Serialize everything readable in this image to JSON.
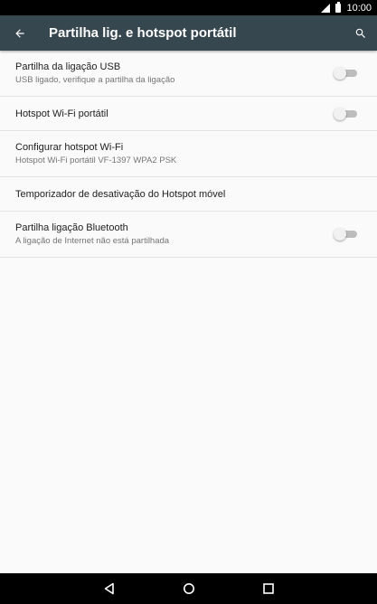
{
  "status_bar": {
    "time": "10:00",
    "icons": [
      "signal-icon",
      "battery-icon"
    ]
  },
  "app_bar": {
    "title": "Partilha lig. e hotspot portátil",
    "back_icon": "arrow-left-icon",
    "search_icon": "search-icon"
  },
  "settings": [
    {
      "title": "Partilha da ligação USB",
      "subtitle": "USB ligado, verifique a partilha da ligação",
      "has_toggle": true,
      "toggle_on": false
    },
    {
      "title": "Hotspot Wi-Fi portátil",
      "subtitle": "",
      "has_toggle": true,
      "toggle_on": false
    },
    {
      "title": "Configurar hotspot Wi-Fi",
      "subtitle": "Hotspot Wi-Fi portátil VF-1397 WPA2 PSK",
      "has_toggle": false
    },
    {
      "title": "Temporizador de desativação do Hotspot móvel",
      "subtitle": "",
      "has_toggle": false
    },
    {
      "title": "Partilha ligação Bluetooth",
      "subtitle": "A ligação de Internet não está partilhada",
      "has_toggle": true,
      "toggle_on": false
    }
  ],
  "nav_bar": {
    "icons": [
      "back-triangle-icon",
      "home-circle-icon",
      "recents-square-icon"
    ]
  },
  "colors": {
    "status_bar": "#000000",
    "app_bar": "#37474f",
    "background": "#fafafa",
    "divider": "#e3e3e3",
    "toggle_track_off": "#bdbdbd",
    "toggle_thumb_off": "#f1f1f1"
  }
}
